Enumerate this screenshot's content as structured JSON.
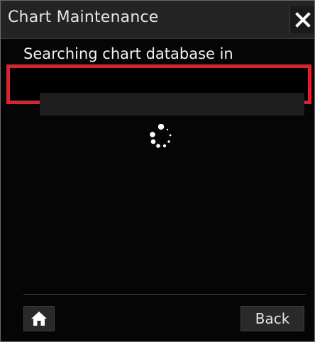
{
  "dialog": {
    "title": "Chart Maintenance",
    "close_icon": "close-icon"
  },
  "main": {
    "message": "Searching chart database in",
    "highlight_color": "#e0202c",
    "spinner_icon": "loading-spinner-icon"
  },
  "footer": {
    "home_icon": "home-icon",
    "back_label": "Back"
  }
}
